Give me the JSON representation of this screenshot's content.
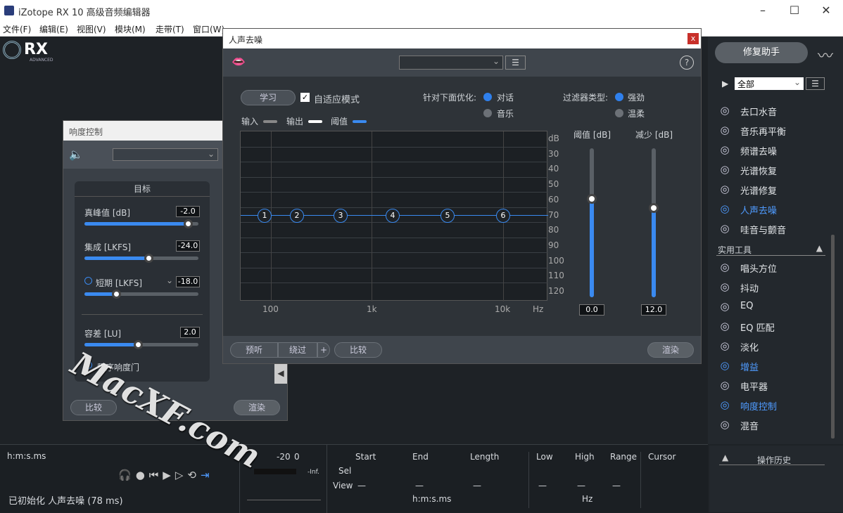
{
  "window": {
    "title": "iZotope RX 10 高级音频编辑器"
  },
  "menu": [
    "文件(F)",
    "编辑(E)",
    "视图(V)",
    "模块(M)",
    "走带(T)",
    "窗口(W)",
    "帮助(H)"
  ],
  "logo": {
    "brand": "RX",
    "sub": "ADVANCED"
  },
  "right_panel": {
    "assistant_label": "修复助手",
    "filter": "全部",
    "modules": [
      {
        "label": "去口水音",
        "icon": "mouth-icon"
      },
      {
        "label": "音乐再平衡",
        "icon": "music-note-icon"
      },
      {
        "label": "频谱去噪",
        "icon": "spectrum-icon"
      },
      {
        "label": "光谱恢复",
        "icon": "restore-icon"
      },
      {
        "label": "光谱修复",
        "icon": "repair-icon"
      },
      {
        "label": "人声去噪",
        "icon": "lips-icon",
        "active": true
      },
      {
        "label": "哇音与颤音",
        "icon": "wow-icon"
      }
    ],
    "utilities_header": "实用工具",
    "utilities": [
      {
        "label": "唱头方位",
        "icon": "azimuth-icon"
      },
      {
        "label": "抖动",
        "icon": "dither-icon"
      },
      {
        "label": "EQ",
        "icon": "eq-icon"
      },
      {
        "label": "EQ 匹配",
        "icon": "eq-match-icon"
      },
      {
        "label": "淡化",
        "icon": "fade-icon"
      },
      {
        "label": "增益",
        "icon": "gain-icon",
        "active": true
      },
      {
        "label": "电平器",
        "icon": "leveler-icon"
      },
      {
        "label": "响度控制",
        "icon": "speaker-icon",
        "active": true
      },
      {
        "label": "混音",
        "icon": "mix-icon"
      }
    ],
    "history_label": "操作历史"
  },
  "loudness": {
    "title": "响度控制",
    "target_label": "目标",
    "true_peak_label": "真峰值 [dB]",
    "true_peak": "-2.0",
    "true_peak_pos": 0.91,
    "integrated_label": "集成 [LKFS]",
    "integrated": "-24.0",
    "integrated_pos": 0.56,
    "short_label": "短期 [LKFS]",
    "short": "-18.0",
    "short_pos": 0.28,
    "tolerance_label": "容差 [LU]",
    "tolerance": "2.0",
    "tolerance_pos": 0.47,
    "gate_label": "程序响度门",
    "compare": "比较",
    "render": "渲染"
  },
  "voice": {
    "title": "人声去噪",
    "learn": "学习",
    "adaptive_label": "自适应模式",
    "adaptive_checked": true,
    "optimize_label": "针对下面优化:",
    "opt_dialogue": "对话",
    "opt_music": "音乐",
    "filter_label": "过滤器类型:",
    "filter_strong": "强劲",
    "filter_soft": "温柔",
    "legend_in": "输入",
    "legend_out": "输出",
    "legend_thr": "阈值",
    "db_ticks": [
      "dB",
      "30",
      "40",
      "50",
      "60",
      "70",
      "80",
      "90",
      "100",
      "110",
      "120"
    ],
    "hz_ticks": [
      "100",
      "1k",
      "10k",
      "Hz"
    ],
    "nodes": [
      "1",
      "2",
      "3",
      "4",
      "5",
      "6"
    ],
    "threshold_label": "阈值 [dB]",
    "threshold": "0.0",
    "threshold_pos": 0.66,
    "reduction_label": "减少 [dB]",
    "reduction": "12.0",
    "reduction_pos": 0.6,
    "preview": "预听",
    "bypass": "绕过",
    "plus": "+",
    "compare": "比较",
    "render": "渲染",
    "close": "x"
  },
  "bottom": {
    "time_format": "h:m:s.ms",
    "status": "已初始化 人声去噪 (78 ms)",
    "meter": [
      "-20",
      "0"
    ],
    "meter_inf": "-Inf.",
    "cols": [
      "Start",
      "End",
      "Length"
    ],
    "sel": "Sel",
    "view": "View",
    "dash": "—",
    "unit_time": "h:m:s.ms",
    "freq_cols": [
      "Low",
      "High",
      "Range"
    ],
    "unit_hz": "Hz",
    "cursor": "Cursor"
  },
  "watermark": "MacXF.com"
}
